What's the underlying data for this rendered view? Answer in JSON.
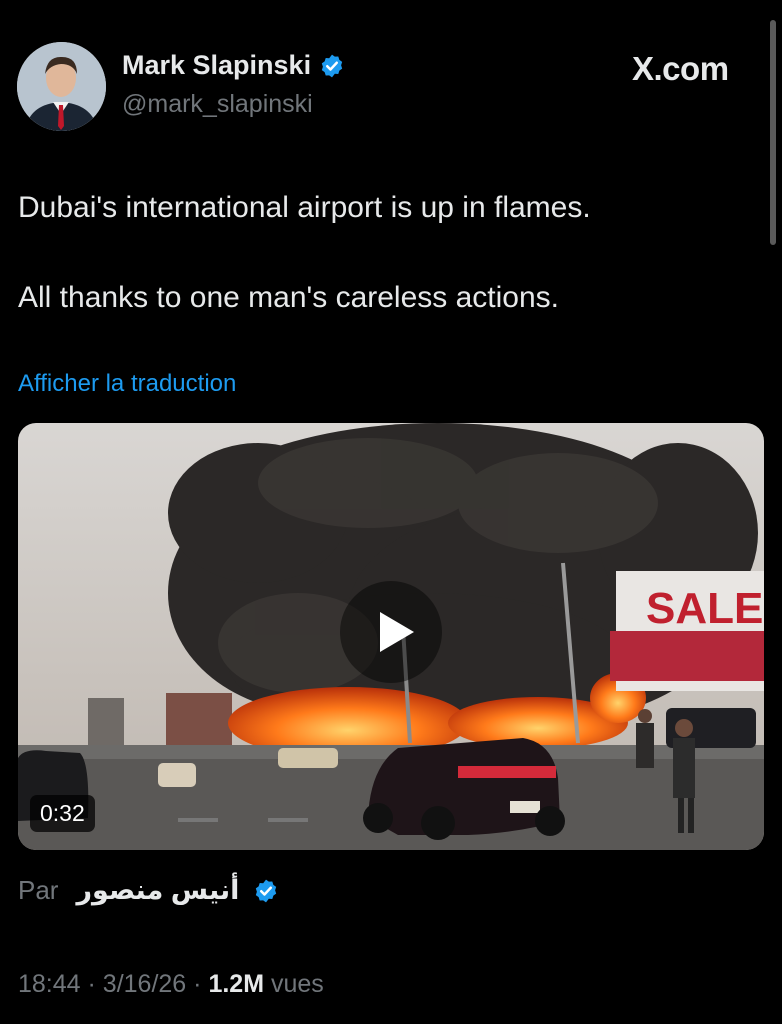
{
  "author": {
    "name": "Mark Slapinski",
    "handle": "@mark_slapinski"
  },
  "site": "X.com",
  "tweet": {
    "line1": "Dubai's international airport is up in flames.",
    "line2": "All thanks to one man's careless actions."
  },
  "translate_link": "Afficher la traduction",
  "video": {
    "duration": "0:32",
    "play_icon": "play-icon",
    "sign_text": "SALE"
  },
  "attribution": {
    "label": "Par",
    "author": "أنيس منصور"
  },
  "meta": {
    "time": "18:44",
    "sep1": "·",
    "date": "3/16/26",
    "sep2": "·",
    "views": "1.2M",
    "views_label": "vues"
  },
  "colors": {
    "background": "#000000",
    "link": "#1d9bf0",
    "verified": "#1d9bf0",
    "secondary_text": "#71767b"
  }
}
